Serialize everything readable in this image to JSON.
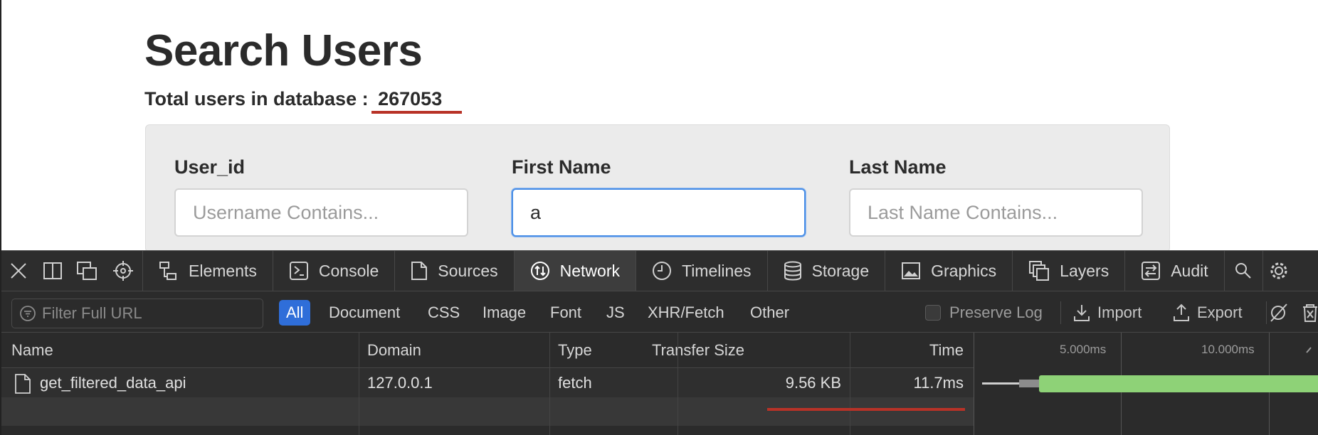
{
  "page": {
    "title": "Search Users",
    "total_label": "Total users in database :",
    "total_count": "267053",
    "fields": [
      {
        "label": "User_id",
        "placeholder": "Username Contains...",
        "value": ""
      },
      {
        "label": "First Name",
        "placeholder": "",
        "value": "a"
      },
      {
        "label": "Last Name",
        "placeholder": "Last Name Contains...",
        "value": ""
      }
    ]
  },
  "devtools": {
    "tabs": [
      {
        "label": "Elements",
        "icon": "elements-icon"
      },
      {
        "label": "Console",
        "icon": "console-icon"
      },
      {
        "label": "Sources",
        "icon": "document-icon"
      },
      {
        "label": "Network",
        "icon": "network-icon",
        "active": true
      },
      {
        "label": "Timelines",
        "icon": "clock-icon"
      },
      {
        "label": "Storage",
        "icon": "database-icon"
      },
      {
        "label": "Graphics",
        "icon": "image-icon"
      },
      {
        "label": "Layers",
        "icon": "layers-icon"
      },
      {
        "label": "Audit",
        "icon": "audit-icon"
      }
    ],
    "filter_placeholder": "Filter Full URL",
    "type_filters": [
      "All",
      "Document",
      "CSS",
      "Image",
      "Font",
      "JS",
      "XHR/Fetch",
      "Other"
    ],
    "active_type_filter": "All",
    "preserve_log_label": "Preserve Log",
    "import_label": "Import",
    "export_label": "Export",
    "columns": [
      "Name",
      "Domain",
      "Type",
      "Transfer Size",
      "Time"
    ],
    "rows": [
      {
        "name": "get_filtered_data_api",
        "domain": "127.0.0.1",
        "type": "fetch",
        "transfer_size": "9.56 KB",
        "time": "11.7ms"
      }
    ],
    "waterfall_ticks": [
      "5.000ms",
      "10.000ms"
    ],
    "colors": {
      "accent": "#2f6ed9",
      "bar_green": "#8ed277",
      "annotation_red": "#b83227"
    }
  }
}
